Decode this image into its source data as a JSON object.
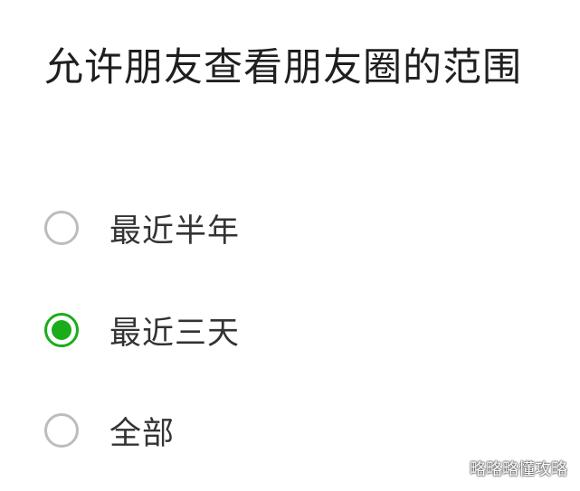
{
  "dialog": {
    "title": "允许朋友查看朋友圈的范围",
    "options": [
      {
        "label": "最近半年",
        "selected": false
      },
      {
        "label": "最近三天",
        "selected": true
      },
      {
        "label": "全部",
        "selected": false
      }
    ]
  },
  "watermark": {
    "text": "略略略懂攻略",
    "icon": "wechat-icon"
  },
  "colors": {
    "accent": "#1aad19",
    "radio_unchecked": "#bcbcbc",
    "text": "#222222"
  }
}
